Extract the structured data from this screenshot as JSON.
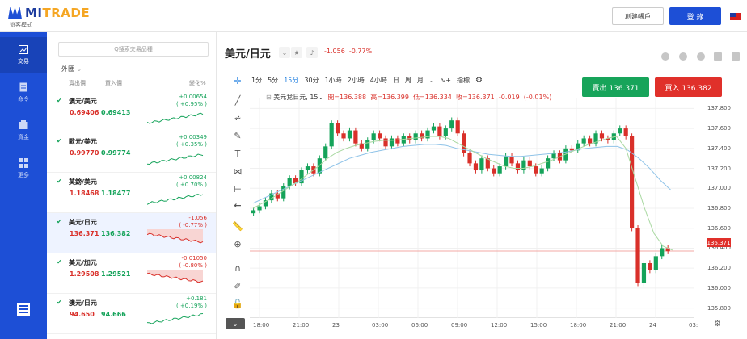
{
  "brand": {
    "name_a": "MI",
    "name_b": "TRADE",
    "subtitle": "遊客模式"
  },
  "header": {
    "register_label": "創建帳戶",
    "login_label": "登 錄"
  },
  "sidebar": {
    "items": [
      {
        "label": "交易",
        "icon": "chart-icon",
        "active": true
      },
      {
        "label": "命令",
        "icon": "document-icon",
        "active": false
      },
      {
        "label": "資金",
        "icon": "wallet-icon",
        "active": false
      },
      {
        "label": "更多",
        "icon": "grid-icon",
        "active": false
      }
    ]
  },
  "panel": {
    "search_placeholder": "Q搜索交易品種",
    "category": "外匯",
    "col_sell": "賣出價",
    "col_buy": "買入價",
    "col_change": "變化%",
    "rows": [
      {
        "name": "澳元/美元",
        "sell": "0.69406",
        "buy": "0.69413",
        "change": "+0.00654",
        "pct": "( +0.95% )",
        "dir": "up"
      },
      {
        "name": "歐元/美元",
        "sell": "0.99770",
        "buy": "0.99774",
        "change": "+0.00349",
        "pct": "( +0.35% )",
        "dir": "up"
      },
      {
        "name": "英鎊/美元",
        "sell": "1.18468",
        "buy": "1.18477",
        "change": "+0.00824",
        "pct": "( +0.70% )",
        "dir": "up"
      },
      {
        "name": "美元/日元",
        "sell": "136.371",
        "buy": "136.382",
        "change": "-1.056",
        "pct": "( -0.77% )",
        "dir": "down"
      },
      {
        "name": "美元/加元",
        "sell": "1.29508",
        "buy": "1.29521",
        "change": "-0.01050",
        "pct": "( -0.80% )",
        "dir": "down"
      },
      {
        "name": "澳元/日元",
        "sell": "94.650",
        "buy": "94.666",
        "change": "+0.181",
        "pct": "( +0.19% )",
        "dir": "up"
      }
    ]
  },
  "chart_header": {
    "symbol": "美元/日元",
    "change": "-1.056",
    "pct": "-0.77%"
  },
  "toolbar": {
    "intervals": [
      "1分",
      "5分",
      "15分",
      "30分",
      "1小時",
      "2小時",
      "4小時",
      "日",
      "周",
      "月"
    ],
    "active": "15分",
    "indicators": "指標"
  },
  "ohlc": {
    "title": "美元兌日元, 15",
    "open": "開=136.388",
    "high": "高=136.399",
    "low": "低=136.334",
    "close": "收=136.371",
    "chg": "-0.019",
    "pct": "(-0.01%)"
  },
  "trade": {
    "sell_label": "賣出 136.371",
    "buy_label": "買入 136.382"
  },
  "colors": {
    "up": "#15a35a",
    "down": "#d9302a",
    "brand": "#1d4fd6"
  },
  "chart_data": {
    "type": "candlestick",
    "price_tag": "136.371",
    "y_ticks": [
      "137.800",
      "137.600",
      "137.400",
      "137.200",
      "137.000",
      "136.800",
      "136.600",
      "136.400",
      "136.200",
      "136.000",
      "135.800"
    ],
    "ylim": [
      135.7,
      137.9
    ],
    "x_ticks": [
      "18:00",
      "21:00",
      "23",
      "03:00",
      "06:00",
      "09:00",
      "12:00",
      "15:00",
      "18:00",
      "21:00",
      "24",
      "03:"
    ],
    "close": [
      136.78,
      136.82,
      136.88,
      136.95,
      136.9,
      137.02,
      137.1,
      137.05,
      137.18,
      137.22,
      137.15,
      137.3,
      137.42,
      137.65,
      137.55,
      137.5,
      137.58,
      137.45,
      137.4,
      137.48,
      137.55,
      137.5,
      137.42,
      137.5,
      137.45,
      137.52,
      137.48,
      137.55,
      137.5,
      137.58,
      137.62,
      137.52,
      137.6,
      137.68,
      137.55,
      137.35,
      137.25,
      137.18,
      137.3,
      137.2,
      137.15,
      137.22,
      137.32,
      137.25,
      137.18,
      137.28,
      137.22,
      137.15,
      137.2,
      137.3,
      137.35,
      137.28,
      137.4,
      137.38,
      137.45,
      137.5,
      137.45,
      137.55,
      137.5,
      137.48,
      137.55,
      137.6,
      137.52,
      136.6,
      136.05,
      136.25,
      136.18,
      136.32,
      136.4,
      136.37
    ],
    "ma_fast": [
      136.8,
      136.85,
      136.9,
      136.96,
      137.02,
      137.08,
      137.15,
      137.22,
      137.3,
      137.36,
      137.4,
      137.43,
      137.45,
      137.47,
      137.48,
      137.48,
      137.49,
      137.5,
      137.51,
      137.52,
      137.52,
      137.5,
      137.45,
      137.4,
      137.35,
      137.3,
      137.26,
      137.22,
      137.2,
      137.2,
      137.22,
      137.25,
      137.28,
      137.32,
      137.36,
      137.4,
      137.44,
      137.47,
      137.5,
      137.52,
      137.4,
      137.1,
      136.8,
      136.55,
      136.42,
      136.38
    ],
    "ma_slow": [
      136.85,
      136.9,
      136.95,
      137.0,
      137.05,
      137.1,
      137.15,
      137.2,
      137.25,
      137.3,
      137.33,
      137.36,
      137.38,
      137.4,
      137.42,
      137.43,
      137.44,
      137.44,
      137.43,
      137.4,
      137.38,
      137.36,
      137.34,
      137.33,
      137.32,
      137.32,
      137.33,
      137.34,
      137.35,
      137.36,
      137.38,
      137.4,
      137.41,
      137.42,
      137.42,
      137.38,
      137.3,
      137.2,
      137.08,
      136.98
    ]
  }
}
